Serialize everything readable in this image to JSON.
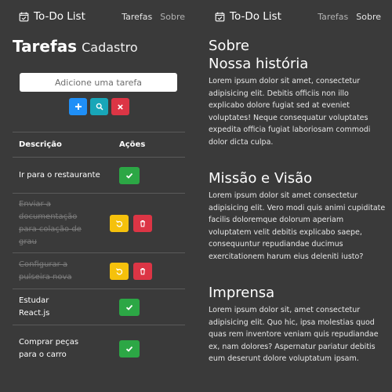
{
  "nav": {
    "brand": "To-Do List",
    "links": [
      "Tarefas",
      "Sobre"
    ]
  },
  "tasks_page": {
    "title": "Tarefas",
    "subtitle": "Cadastro",
    "input_placeholder": "Adicione uma tarefa",
    "buttons": {
      "add": "+",
      "search": "search-icon",
      "clear": "×"
    },
    "table": {
      "headers": {
        "description": "Descrição",
        "actions": "Ações"
      },
      "rows": [
        {
          "text": "Ir para o restaurante",
          "done": false
        },
        {
          "text": "Enviar a documentação para colação de grau",
          "done": true
        },
        {
          "text": "Configurar a pulseira nova",
          "done": true
        },
        {
          "text": "Estudar React.js",
          "done": false
        },
        {
          "text": "Comprar peças para o carro",
          "done": false
        }
      ]
    }
  },
  "about_page": {
    "title": "Sobre",
    "sections": [
      {
        "heading": "Nossa história",
        "text": "Lorem ipsum dolor sit amet, consectetur adipisicing elit. Debitis officiis non illo explicabo dolore fugiat sed at eveniet voluptates! Neque consequatur voluptates expedita officia fugiat laboriosam commodi dolor dicta culpa."
      },
      {
        "heading": "Missão e Visão",
        "text": "Lorem ipsum dolor sit amet consectetur adipisicing elit. Vero modi quis animi cupiditate facilis doloremque dolorum aperiam voluptatem velit debitis explicabo saepe, consequuntur repudiandae ducimus exercitationem harum eius deleniti iusto?"
      },
      {
        "heading": "Imprensa",
        "text": "Lorem ipsum dolor sit, amet consectetur adipisicing elit. Quo hic, ipsa molestias quod quas rem inventore veniam quis repudiandae ex, nam dolores? Aspernatur pariatur debitis eum deserunt dolore voluptatum ipsam."
      }
    ]
  },
  "colors": {
    "background": "#3a3a3a",
    "primary": "#1f8ff7",
    "info": "#18a6b8",
    "danger": "#dc3545",
    "success": "#2ca745",
    "warning": "#f5c10c"
  }
}
